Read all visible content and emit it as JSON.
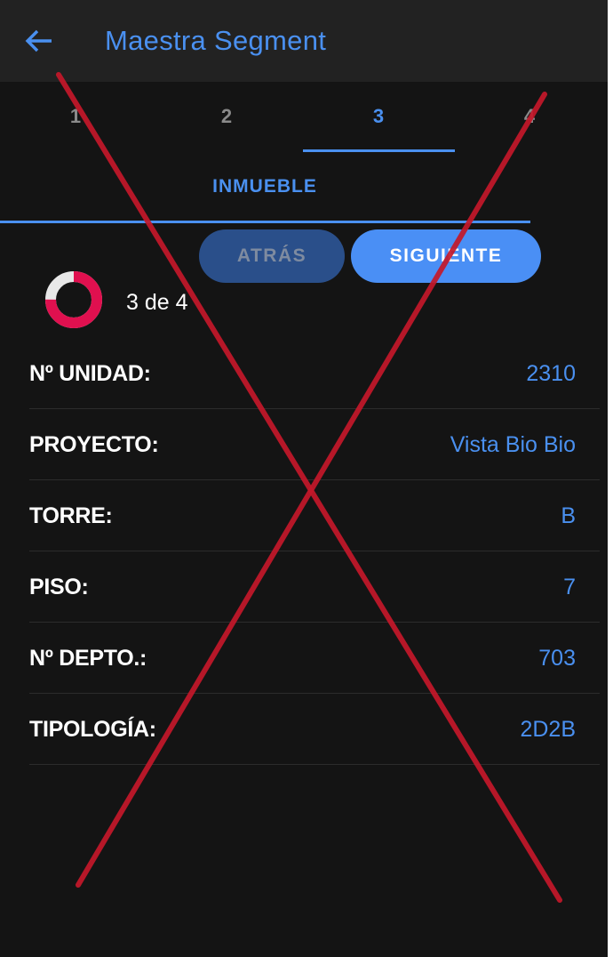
{
  "header": {
    "title": "Maestra Segment",
    "back_icon": "arrow-left-icon"
  },
  "steps": [
    {
      "label": "1",
      "active": false
    },
    {
      "label": "2",
      "active": false
    },
    {
      "label": "3",
      "active": true
    },
    {
      "label": "4",
      "active": false
    }
  ],
  "section": {
    "label": "INMUEBLE"
  },
  "buttons": {
    "back": "ATRÁS",
    "next": "SIGUIENTE"
  },
  "progress": {
    "text": "3 de 4",
    "current": 3,
    "total": 4
  },
  "fields": [
    {
      "label": "Nº UNIDAD:",
      "value": "2310"
    },
    {
      "label": "PROYECTO:",
      "value": "Vista Bio Bio"
    },
    {
      "label": "TORRE:",
      "value": "B"
    },
    {
      "label": "PISO:",
      "value": "7"
    },
    {
      "label": "Nº DEPTO.:",
      "value": "703"
    },
    {
      "label": "TIPOLOGÍA:",
      "value": "2D2B"
    }
  ],
  "colors": {
    "accent": "#4a90f0",
    "progress": "#e0104f",
    "overlay_cross": "#c4182a"
  }
}
